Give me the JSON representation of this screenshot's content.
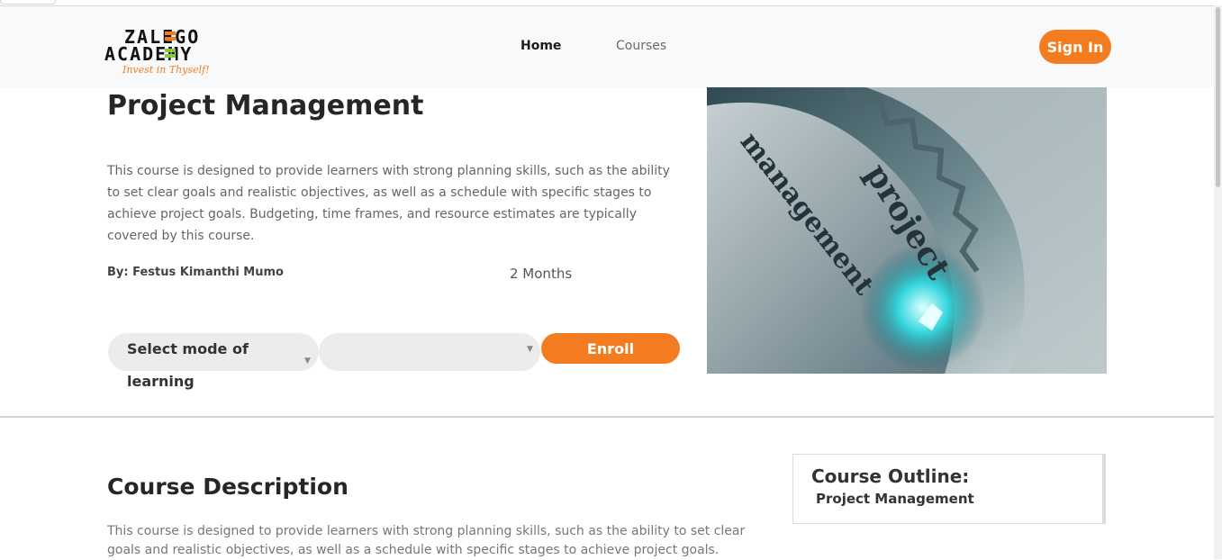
{
  "header": {
    "logo": {
      "line1": "ZALEGO",
      "line2": "ACADEMY",
      "tagline": "Invest in Thyself!"
    },
    "nav": {
      "home": "Home",
      "courses": "Courses"
    },
    "signin_label": "Sign In"
  },
  "course": {
    "title": "Project Management",
    "summary": "This course is designed to provide learners with strong planning skills, such as the ability to set clear goals and realistic objectives, as well as a schedule with specific stages to achieve project goals. Budgeting, time frames, and resource estimates are typically covered by this course.",
    "instructor": "By: Festus Kimanthi Mumo",
    "duration": "2 Months",
    "image_text": {
      "word1": "project",
      "word2": "management"
    }
  },
  "enroll_form": {
    "mode_select_value": "Select mode of learning",
    "second_select_value": "",
    "enroll_label": "Enroll"
  },
  "description": {
    "title": "Course Description",
    "text": "This course is designed to provide learners with strong planning skills, such as the ability to set clear goals and realistic objectives, as well as a schedule with specific stages to achieve project goals."
  },
  "outline": {
    "title": "Course Outline:",
    "items": [
      "Project Management"
    ]
  },
  "colors": {
    "accent": "#f47c20",
    "navbar_bg": "#f8f9fa",
    "select_bg": "#ececec"
  },
  "icons": {
    "caret": "caret-down-icon"
  }
}
